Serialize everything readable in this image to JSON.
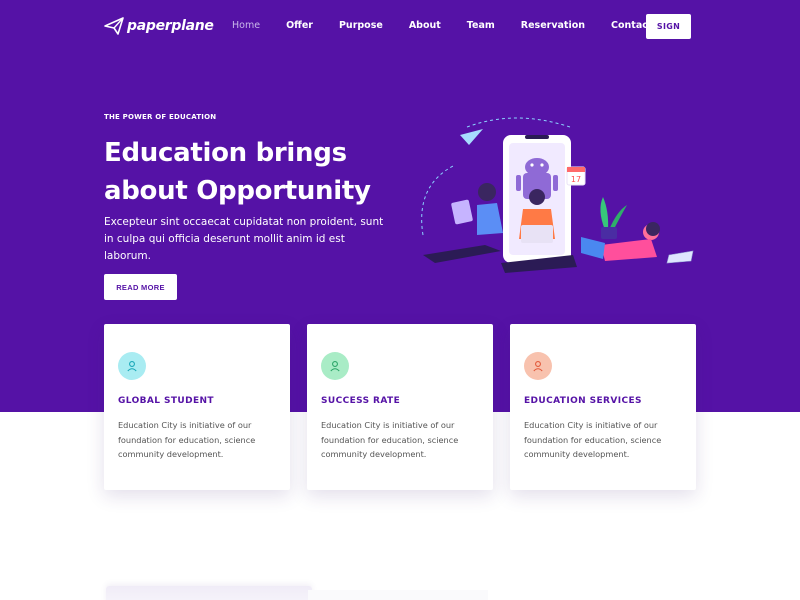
{
  "brand": {
    "name": "paperplane"
  },
  "nav": {
    "items": [
      {
        "label": "Home",
        "active": true
      },
      {
        "label": "Offer"
      },
      {
        "label": "Purpose"
      },
      {
        "label": "About"
      },
      {
        "label": "Team"
      },
      {
        "label": "Reservation"
      },
      {
        "label": "Contact"
      }
    ],
    "sign_label": "SIGN"
  },
  "hero": {
    "eyebrow": "THE POWER OF EDUCATION",
    "title_line1": "Education brings",
    "title_line2": "about Opportunity",
    "lead": "Excepteur sint occaecat cupidatat non proident, sunt in culpa qui officia deserunt mollit anim id est laborum.",
    "button_label": "READ MORE",
    "calendar_day": "17"
  },
  "features": [
    {
      "title": "GLOBAL STUDENT",
      "desc": "Education City is initiative of our foundation for education, science community development.",
      "icon": "user-icon",
      "icon_bg": "#a9ecf2",
      "icon_color": "#19a7b8"
    },
    {
      "title": "SUCCESS RATE",
      "desc": "Education City is initiative of our foundation for education, science community development.",
      "icon": "user-icon",
      "icon_bg": "#a9ecc6",
      "icon_color": "#2aa567"
    },
    {
      "title": "EDUCATION SERVICES",
      "desc": "Education City is initiative of our foundation for education, science community development.",
      "icon": "user-icon",
      "icon_bg": "#f8c2ae",
      "icon_color": "#e2583a"
    }
  ],
  "colors": {
    "brand": "#5512a6",
    "text_dark": "#555555",
    "white": "#ffffff"
  }
}
